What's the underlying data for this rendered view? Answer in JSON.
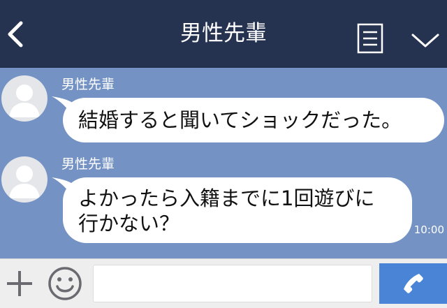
{
  "header": {
    "title": "男性先輩",
    "back_icon": "chevron-left-icon",
    "menu_icon": "document-list-icon",
    "expand_icon": "chevron-down-icon"
  },
  "messages": [
    {
      "sender": "男性先輩",
      "text": "結婚すると聞いてショックだった。"
    },
    {
      "sender": "男性先輩",
      "text": "よかったら入籍までに1回遊びに\n行かない？",
      "time": "10:00"
    }
  ],
  "input_bar": {
    "plus_icon": "plus-icon",
    "emoji_icon": "smiley-icon",
    "input_value": "",
    "call_icon": "phone-icon"
  },
  "colors": {
    "header_bg": "#263350",
    "chat_bg": "#7493c4",
    "bubble_bg": "#ffffff",
    "call_button_bg": "#4a84d6"
  }
}
